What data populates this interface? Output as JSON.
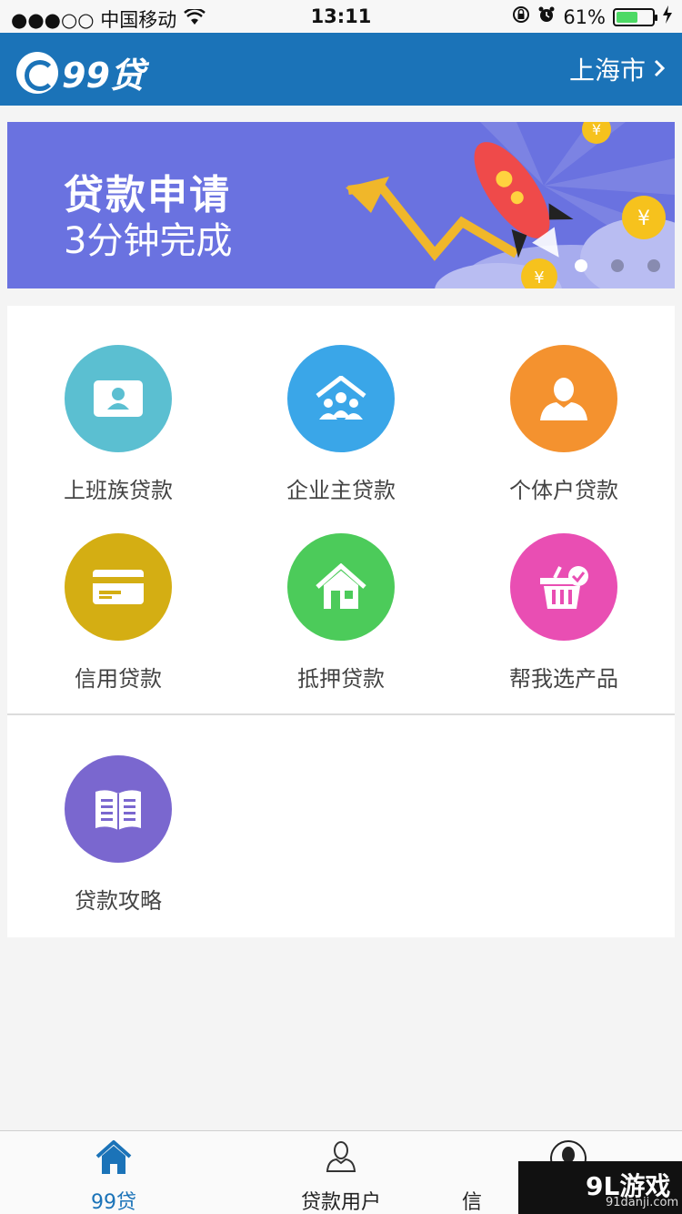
{
  "status_bar": {
    "carrier": "●●●○○ 中国移动",
    "time": "13:11",
    "battery_percent": "61%",
    "battery_level": 0.61
  },
  "header": {
    "logo_text": "99贷",
    "city": "上海市"
  },
  "banner": {
    "title": "贷款申请",
    "subtitle": "3分钟完成",
    "slide_count": 3,
    "active_slide": 1
  },
  "categories": [
    {
      "label": "上班族贷款",
      "icon": "id-card-icon",
      "color": "#5bbfd1"
    },
    {
      "label": "企业主贷款",
      "icon": "group-house-icon",
      "color": "#3aa6e8"
    },
    {
      "label": "个体户贷款",
      "icon": "person-icon",
      "color": "#f4922f"
    },
    {
      "label": "信用贷款",
      "icon": "credit-card-icon",
      "color": "#d4ae13"
    },
    {
      "label": "抵押贷款",
      "icon": "house-icon",
      "color": "#4ccb5a"
    },
    {
      "label": "帮我选产品",
      "icon": "basket-icon",
      "color": "#e94eb3"
    },
    {
      "label": "贷款攻略",
      "icon": "book-icon",
      "color": "#7a67cf"
    }
  ],
  "tabs": [
    {
      "label": "99贷",
      "icon": "home-icon",
      "active": true
    },
    {
      "label": "贷款用户",
      "icon": "user-outline-icon",
      "active": false
    },
    {
      "label": "信",
      "icon": "user-filled-icon",
      "active": false
    }
  ],
  "watermark": {
    "main": "9L游戏",
    "sub": "91danji.com"
  }
}
